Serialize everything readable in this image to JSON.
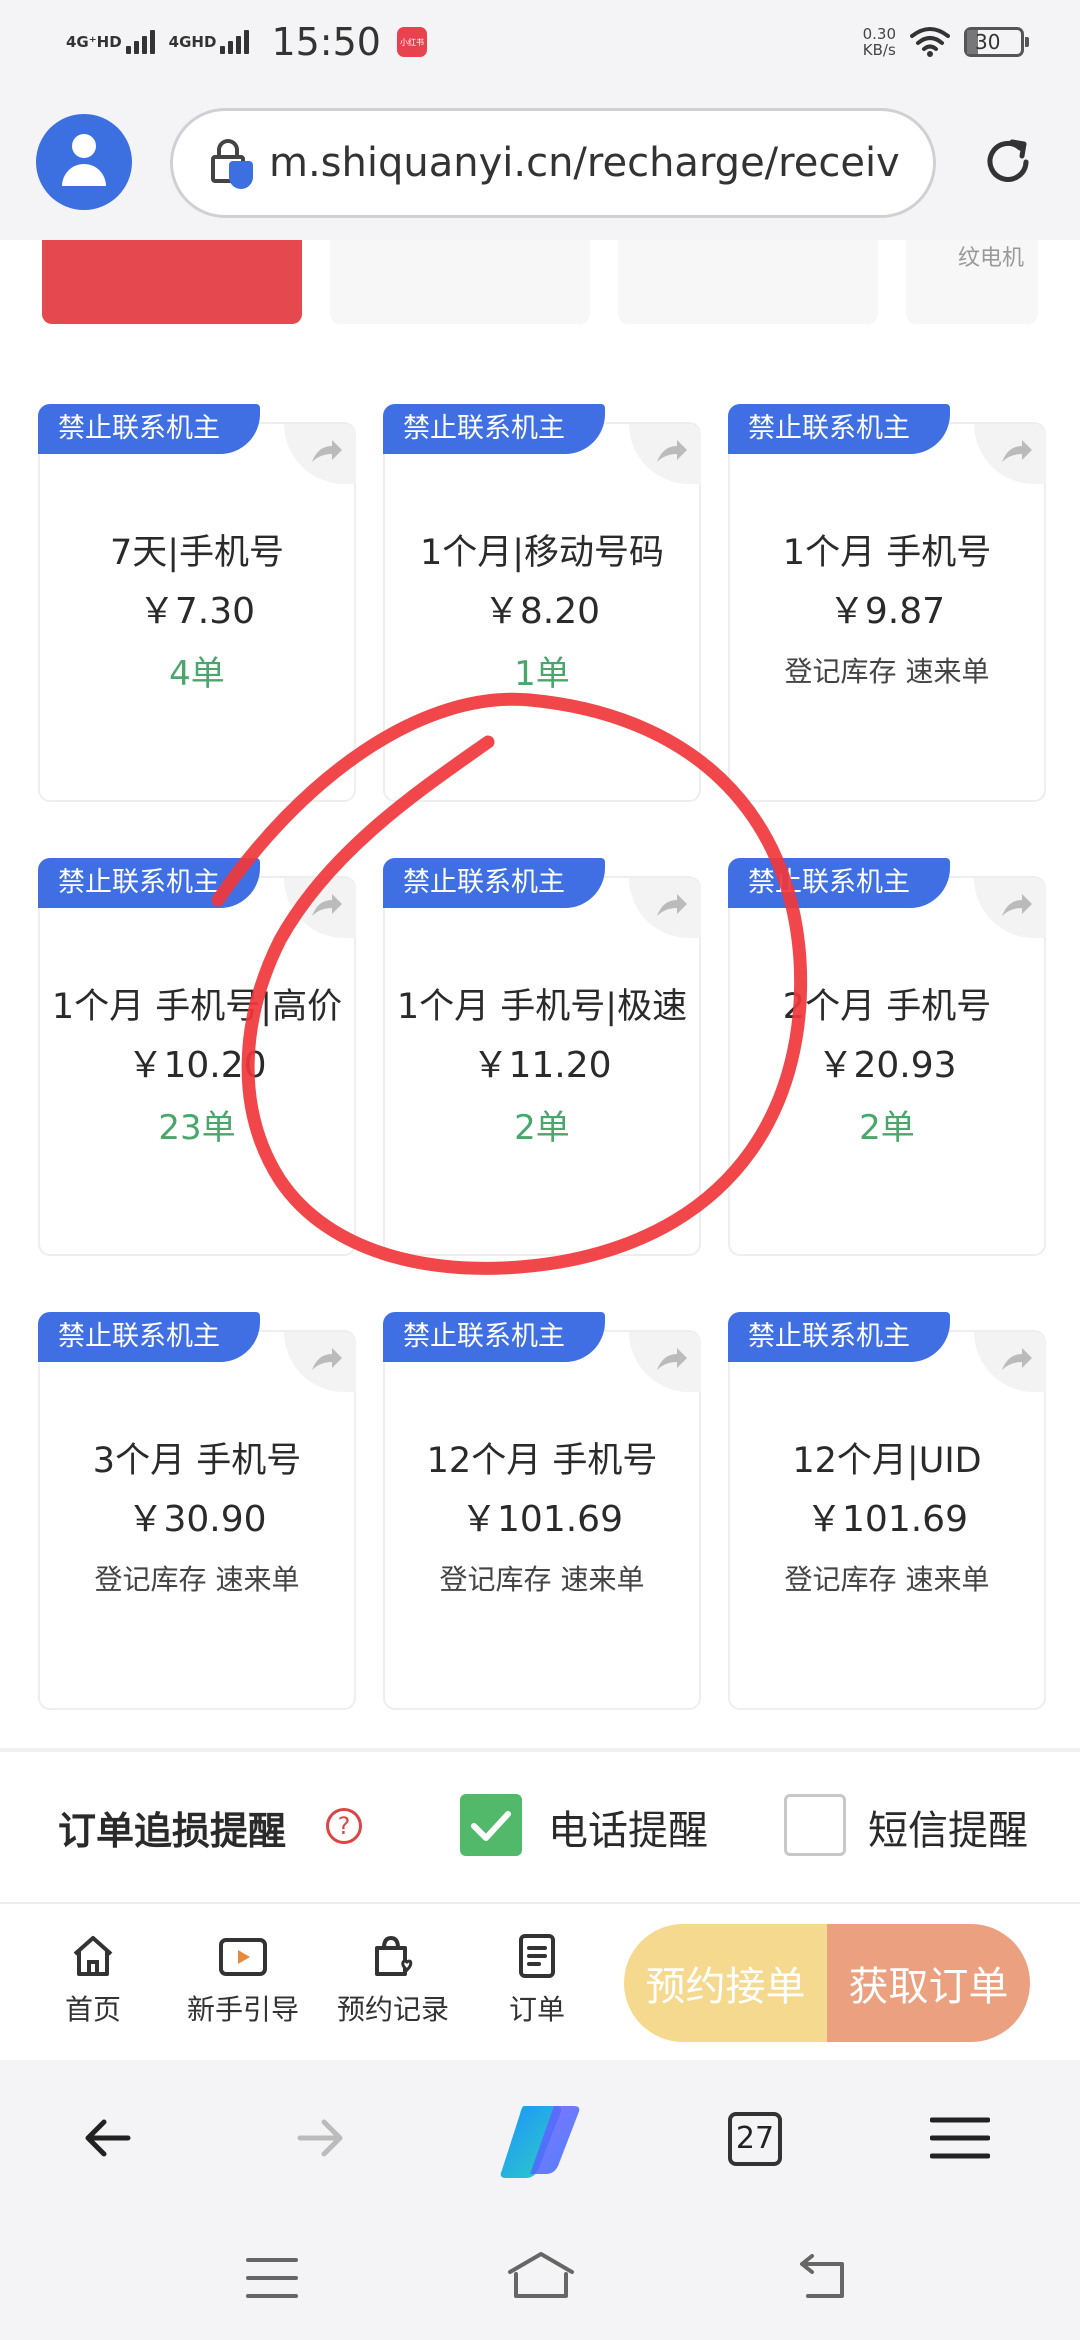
{
  "status_bar": {
    "network_1": "4G⁺HD",
    "network_2": "4GHD",
    "time": "15:50",
    "app_badge": "小红书",
    "speed_value": "0.30",
    "speed_unit": "KB/s",
    "battery": "30"
  },
  "browser": {
    "url": "m.shiquanyi.cn/recharge/receiv",
    "tab_count": "27"
  },
  "top_strip": {
    "partial_label": "纹电机"
  },
  "cards": [
    {
      "tag": "禁止联系机主",
      "name": "7天|手机号",
      "price": "￥7.30",
      "sub": "4单"
    },
    {
      "tag": "禁止联系机主",
      "name": "1个月|移动号码",
      "price": "￥8.20",
      "sub": "1单"
    },
    {
      "tag": "禁止联系机主",
      "name": "1个月 手机号",
      "price": "￥9.87",
      "sub": "登记库存 速来单"
    },
    {
      "tag": "禁止联系机主",
      "name": "1个月 手机号|高价",
      "price": "￥10.20",
      "sub": "23单"
    },
    {
      "tag": "禁止联系机主",
      "name": "1个月 手机号|极速",
      "price": "￥11.20",
      "sub": "2单"
    },
    {
      "tag": "禁止联系机主",
      "name": "2个月 手机号",
      "price": "￥20.93",
      "sub": "2单"
    },
    {
      "tag": "禁止联系机主",
      "name": "3个月 手机号",
      "price": "￥30.90",
      "sub": "登记库存 速来单"
    },
    {
      "tag": "禁止联系机主",
      "name": "12个月 手机号",
      "price": "￥101.69",
      "sub": "登记库存 速来单"
    },
    {
      "tag": "禁止联系机主",
      "name": "12个月|UID",
      "price": "￥101.69",
      "sub": "登记库存 速来单"
    }
  ],
  "reminder": {
    "title": "订单追损提醒",
    "help": "?",
    "phone_label": "电话提醒",
    "phone_checked": true,
    "sms_label": "短信提醒",
    "sms_checked": false
  },
  "bottom_nav": {
    "home": "首页",
    "guide": "新手引导",
    "records": "预约记录",
    "orders": "订单",
    "reserve_button": "预约接单",
    "get_order_button": "获取订单"
  },
  "colors": {
    "tag_blue": "#3f6fe3",
    "count_green": "#4aa66a",
    "annotation_red": "#f0373c",
    "check_green": "#52b96a"
  },
  "icons": [
    "back-arrow-icon",
    "forward-arrow-icon",
    "copilot-icon",
    "menu-icon",
    "reload-icon",
    "lock-shield-icon",
    "share-icon"
  ]
}
